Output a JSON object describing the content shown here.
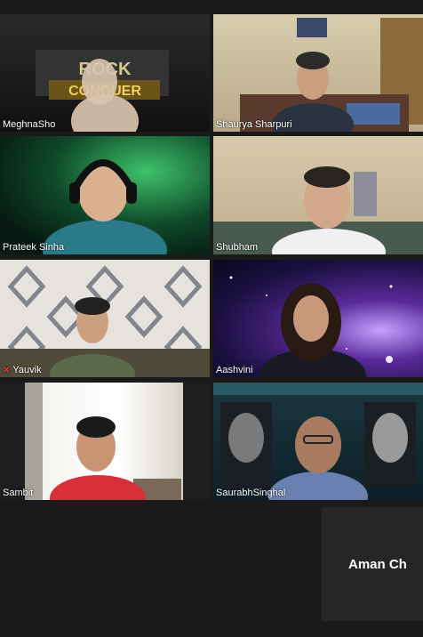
{
  "participants": [
    {
      "name": "MeghnaSho",
      "muted": false
    },
    {
      "name": "Shaurya Sharpuri",
      "muted": false
    },
    {
      "name": "Prateek Sinha",
      "muted": false
    },
    {
      "name": "Shubham",
      "muted": false
    },
    {
      "name": "Yauvik",
      "muted": true
    },
    {
      "name": "Aashvini",
      "muted": false
    },
    {
      "name": "Sambit",
      "muted": false
    },
    {
      "name": "SaurabhSinghal",
      "muted": false
    }
  ],
  "background_text": {
    "line1": "ROCK",
    "line2": "CONQUER"
  },
  "self_view": {
    "name": "Aman Ch"
  },
  "colors": {
    "background": "#1a1a1a",
    "muted_icon": "#e23a3a"
  }
}
